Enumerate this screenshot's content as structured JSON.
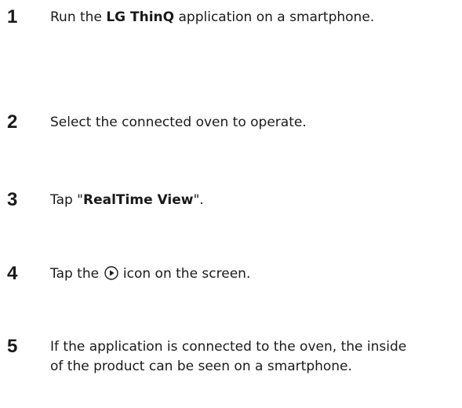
{
  "steps": [
    {
      "number": "1",
      "text_before": "Run the ",
      "bold": "LG ThinQ",
      "text_after": " application on a smartphone."
    },
    {
      "number": "2",
      "text": "Select the connected oven to operate."
    },
    {
      "number": "3",
      "text_before": "Tap \"",
      "bold": "RealTime View",
      "text_after": "\"."
    },
    {
      "number": "4",
      "text_before": "Tap the ",
      "icon": "play-circle-icon",
      "text_after": " icon on the screen."
    },
    {
      "number": "5",
      "text": "If the application is connected to the oven, the inside of the product can be seen on a smartphone."
    }
  ]
}
